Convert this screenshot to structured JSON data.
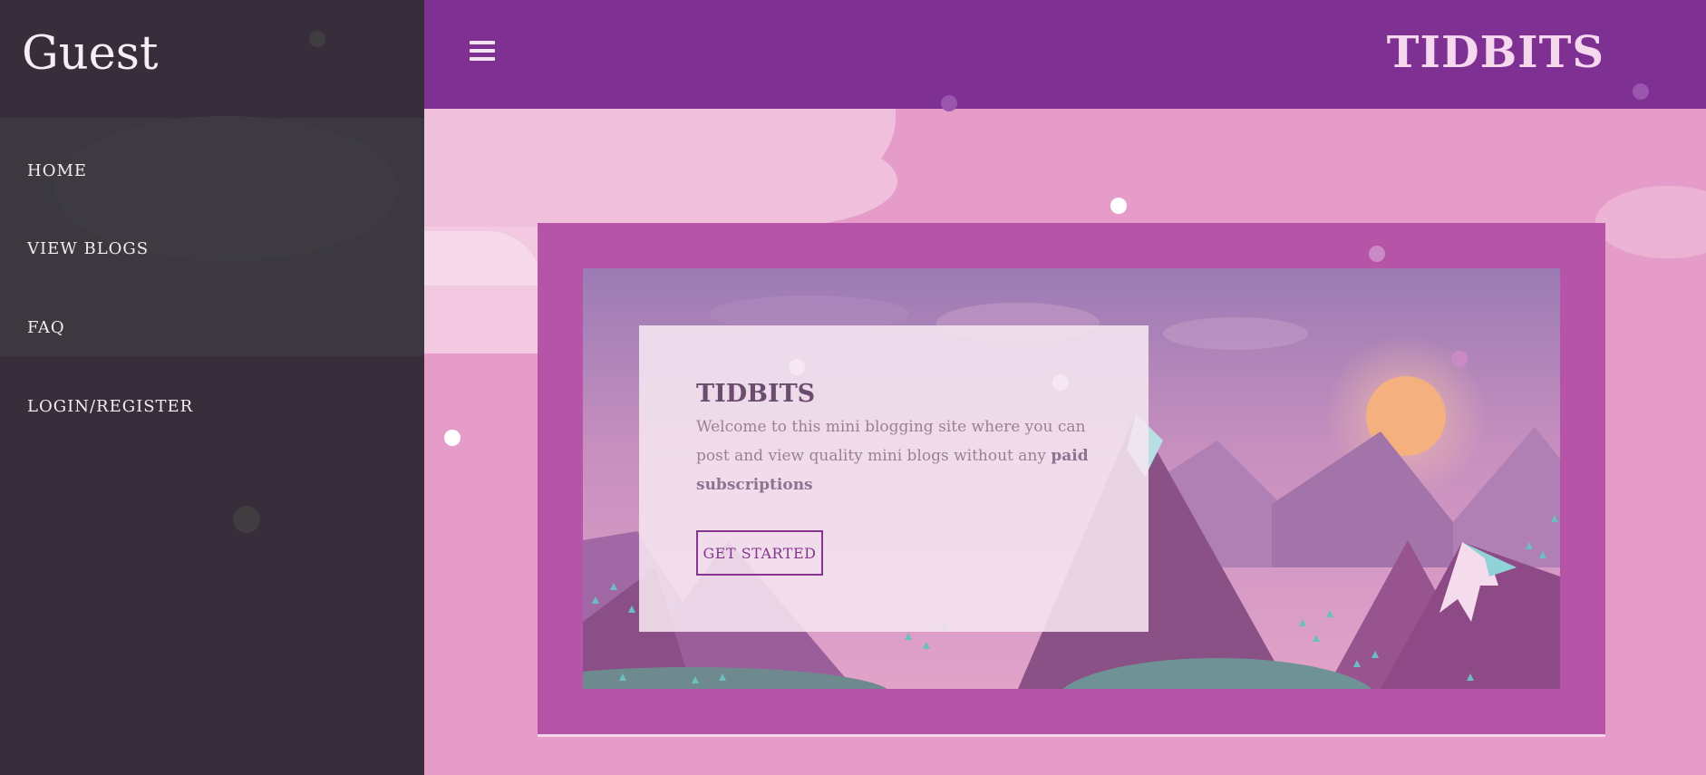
{
  "sidebar": {
    "title": "Guest",
    "items": [
      {
        "label": "HOME"
      },
      {
        "label": "VIEW BLOGS"
      },
      {
        "label": "FAQ"
      },
      {
        "label": "LOGIN/REGISTER"
      }
    ]
  },
  "header": {
    "menu_icon": "hamburger-menu-icon",
    "brand": "TIDBITS"
  },
  "hero": {
    "title": "TIDBITS",
    "text_before": "Welcome to this mini blogging site where you can post and view quality mini blogs without any ",
    "text_bold": "paid subscriptions",
    "button_label": "GET STARTED"
  },
  "colors": {
    "sidebar_bg": "#372d3b",
    "topbar_bg": "#7e3093",
    "page_bg": "#e69cc9",
    "frame_bg": "#b655a7",
    "accent": "#86358f"
  }
}
